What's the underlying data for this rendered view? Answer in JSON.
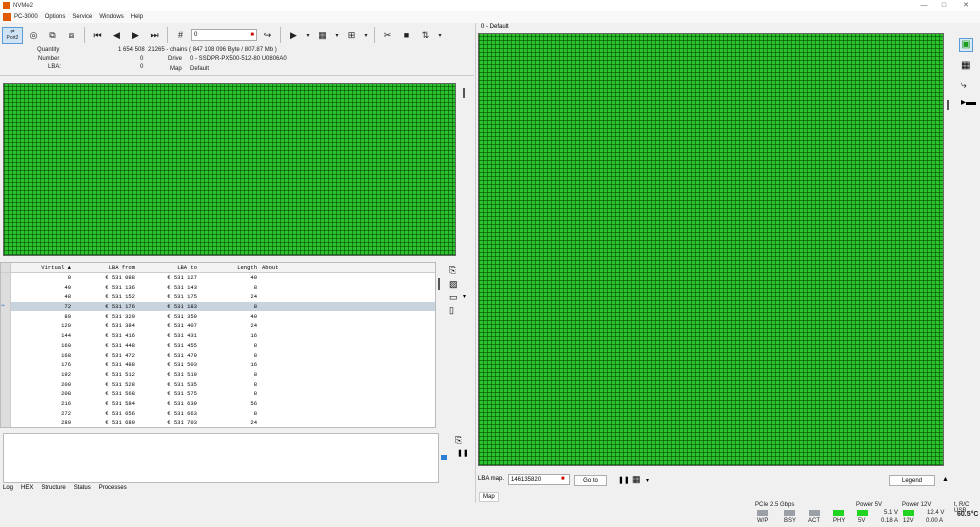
{
  "app": {
    "title": "NVMe2",
    "window_controls": [
      "—",
      "□",
      "✕"
    ]
  },
  "menu": [
    "PC-3000",
    "Options",
    "Service",
    "Windows",
    "Help"
  ],
  "toolbar": {
    "port_label": "Port2",
    "lba_value": "0"
  },
  "info": {
    "quantity_label": "Quantity",
    "quantity_value": "1 654 508",
    "quantity_detail": "21265 - chains  ( 847 108 096 Byte / 807.87 Mb )",
    "number_label": "Number",
    "number_value": "0",
    "drive_label": "Drive",
    "drive_value": "0 - SSDPR-PX500-512-80 U0806A0",
    "lba_label": "LBA:",
    "lba_value": "0",
    "map_label": "Map",
    "map_value": "Default"
  },
  "table": {
    "headers": [
      "Virtual ▲",
      "LBA from",
      "LBA to",
      "Length",
      "About"
    ],
    "rows": [
      [
        "0",
        "€ 531 088",
        "€ 531 127",
        "40",
        ""
      ],
      [
        "40",
        "€ 531 136",
        "€ 531 143",
        "8",
        ""
      ],
      [
        "48",
        "€ 531 152",
        "€ 531 175",
        "24",
        ""
      ],
      [
        "72",
        "€ 531 176",
        "€ 531 183",
        "8",
        ""
      ],
      [
        "80",
        "€ 531 320",
        "€ 531 359",
        "40",
        ""
      ],
      [
        "120",
        "€ 531 384",
        "€ 531 407",
        "24",
        ""
      ],
      [
        "144",
        "€ 531 416",
        "€ 531 431",
        "16",
        ""
      ],
      [
        "160",
        "€ 531 448",
        "€ 531 455",
        "8",
        ""
      ],
      [
        "168",
        "€ 531 472",
        "€ 531 479",
        "8",
        ""
      ],
      [
        "176",
        "€ 531 488",
        "€ 531 503",
        "16",
        ""
      ],
      [
        "192",
        "€ 531 512",
        "€ 531 519",
        "8",
        ""
      ],
      [
        "200",
        "€ 531 528",
        "€ 531 535",
        "8",
        ""
      ],
      [
        "208",
        "€ 531 568",
        "€ 531 575",
        "8",
        ""
      ],
      [
        "216",
        "€ 531 584",
        "€ 531 639",
        "56",
        ""
      ],
      [
        "272",
        "€ 531 656",
        "€ 531 663",
        "8",
        ""
      ],
      [
        "280",
        "€ 531 680",
        "€ 531 703",
        "24",
        ""
      ]
    ],
    "selected_row": 3
  },
  "bottom_tabs": [
    "Log",
    "HEX",
    "Structure",
    "Status",
    "Processes"
  ],
  "right_panel": {
    "title": "0 - Default",
    "lba_map_label": "LBA map.",
    "lba_map_value": "146135820",
    "goto_label": "Go to",
    "legend_label": "Legend",
    "tab_label": "Map"
  },
  "status": {
    "pcie": "PCIe 2.5 Gbps",
    "leds": [
      "W/P",
      "BSY",
      "ACT",
      "PHY"
    ],
    "power5_label": "Power 5V",
    "power5_led": "5V",
    "power5_v": "5.1 V",
    "power5_a": "0.18 A",
    "power12_label": "Power 12V",
    "power12_led": "12V",
    "power12_v": "12.4 V",
    "power12_a": "0.00 A",
    "temp_label": "t, R/C USB",
    "temp_value": "60.5°C"
  },
  "colors": {
    "map_green": "#2dc12d",
    "led_on": "#21d421",
    "led_off": "#9aa0a6",
    "brand": "#e05a00"
  }
}
